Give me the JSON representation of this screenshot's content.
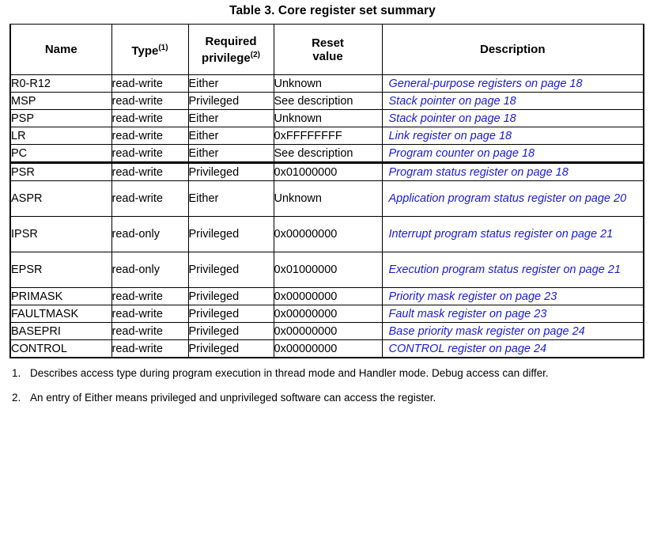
{
  "title": "Table 3. Core register set summary",
  "table": {
    "columns": [
      {
        "label": "Name",
        "sup": ""
      },
      {
        "label": "Type",
        "sup": "(1)"
      },
      {
        "label": "Required\nprivilege",
        "sup": "(2)"
      },
      {
        "label": "Reset\nvalue",
        "sup": ""
      },
      {
        "label": "Description",
        "sup": ""
      }
    ],
    "header": {
      "name": "Name",
      "type": "Type",
      "type_sup": "(1)",
      "privilege_line1": "Required",
      "privilege_line2": "privilege",
      "privilege_sup": "(2)",
      "reset_line1": "Reset",
      "reset_line2": "value",
      "description": "Description"
    },
    "rows": [
      {
        "name": "R0-R12",
        "type": "read-write",
        "privilege": "Either",
        "reset": "Unknown",
        "description": "General-purpose registers on page 18"
      },
      {
        "name": "MSP",
        "type": "read-write",
        "privilege": "Privileged",
        "reset": "See description",
        "description": "Stack pointer on page 18"
      },
      {
        "name": "PSP",
        "type": "read-write",
        "privilege": "Either",
        "reset": "Unknown",
        "description": "Stack pointer on page 18"
      },
      {
        "name": "LR",
        "type": "read-write",
        "privilege": "Either",
        "reset": "0xFFFFFFFF",
        "description": "Link register on page 18"
      },
      {
        "name": "PC",
        "type": "read-write",
        "privilege": "Either",
        "reset": "See description",
        "description": "Program counter on page 18"
      },
      {
        "name": "PSR",
        "type": "read-write",
        "privilege": "Privileged",
        "reset": "0x01000000",
        "description": "Program status register on page 18"
      },
      {
        "name": "ASPR",
        "type": "read-write",
        "privilege": "Either",
        "reset": "Unknown",
        "description": "Application program status register on page 20"
      },
      {
        "name": "IPSR",
        "type": "read-only",
        "privilege": "Privileged",
        "reset": "0x00000000",
        "description": "Interrupt program status register on page 21"
      },
      {
        "name": "EPSR",
        "type": "read-only",
        "privilege": "Privileged",
        "reset": "0x01000000",
        "description": "Execution program status register on page 21"
      },
      {
        "name": "PRIMASK",
        "type": "read-write",
        "privilege": "Privileged",
        "reset": "0x00000000",
        "description": "Priority mask register on page 23"
      },
      {
        "name": "FAULTMASK",
        "type": "read-write",
        "privilege": "Privileged",
        "reset": "0x00000000",
        "description": "Fault mask register on page 23"
      },
      {
        "name": "BASEPRI",
        "type": "read-write",
        "privilege": "Privileged",
        "reset": "0x00000000",
        "description": "Base priority mask register on page 24"
      },
      {
        "name": "CONTROL",
        "type": "read-write",
        "privilege": "Privileged",
        "reset": "0x00000000",
        "description": "CONTROL register on page 24"
      }
    ]
  },
  "footnotes": [
    {
      "number": "1.",
      "text": "Describes access type during program execution in thread mode and Handler mode. Debug access can differ."
    },
    {
      "number": "2.",
      "text": "An entry of Either means privileged and unprivileged software can access the register."
    }
  ],
  "colors": {
    "link_blue": "#1b1bd6",
    "text_black": "#000000",
    "background": "#ffffff"
  }
}
